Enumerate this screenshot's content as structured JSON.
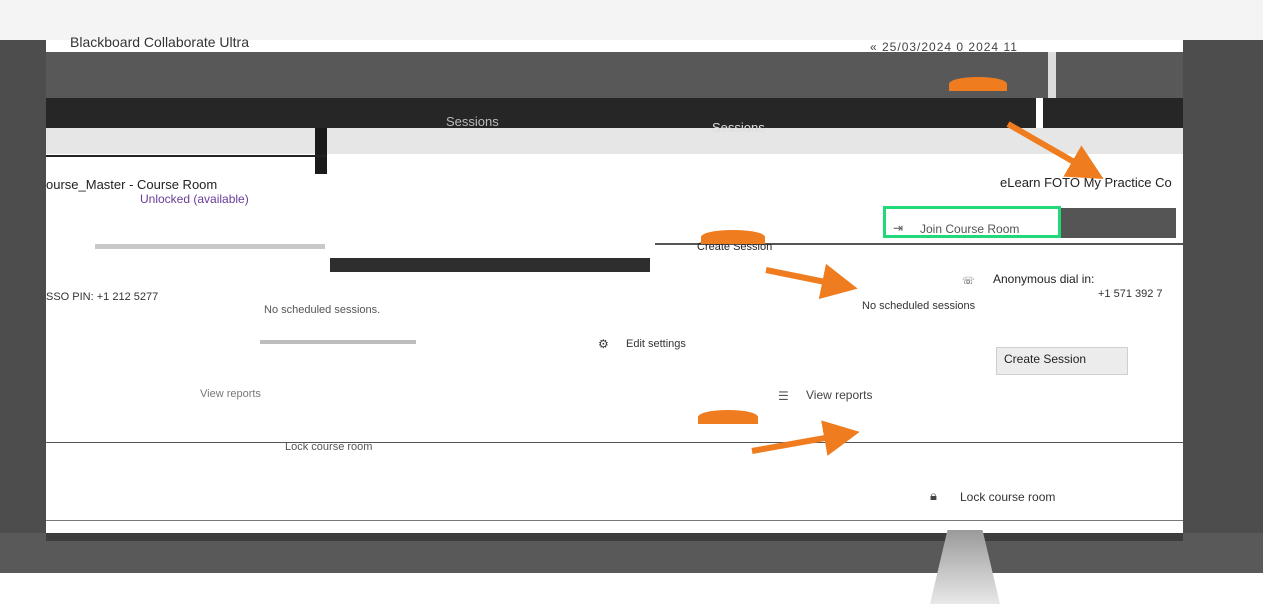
{
  "app": {
    "title": "Blackboard Collaborate Ultra",
    "subtitle": "",
    "date_text": "« 25/03/2024 0 2024 11"
  },
  "header": {
    "tab_sessions": "Sessions",
    "tab_sessions_2": "Sessions"
  },
  "left_panel": {
    "course_title": "ourse_Master - Course Room",
    "lock_status": "Unlocked (available)",
    "pin": "SSO PIN: +1 212 5277",
    "no_sessions": "No scheduled sessions.",
    "view_reports": "View reports",
    "lock": "Lock course room"
  },
  "right_panel": {
    "title": "eLearn FOTO My Practice Co",
    "join_label": "Join Course Room",
    "create_session_top": "Create Session",
    "dial_in_label": "Anonymous dial in:",
    "dial_in_number": "+1 571 392 7",
    "no_scheduled": "No scheduled sessions",
    "edit_settings": "Edit settings",
    "create_session_button": "Create Session",
    "view_reports": "View reports",
    "lock_room": "Lock course room"
  },
  "annotations": {
    "accent_color": "#ef7d1f",
    "highlight_color": "#22d97a"
  }
}
